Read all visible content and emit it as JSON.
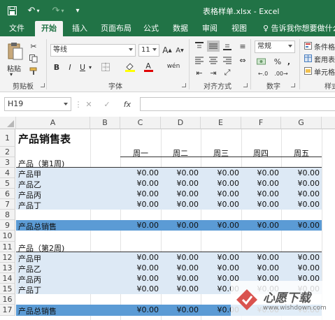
{
  "window": {
    "title": "表格样单.xlsx - Excel"
  },
  "tabs": [
    {
      "label": "文件"
    },
    {
      "label": "开始"
    },
    {
      "label": "插入"
    },
    {
      "label": "页面布局"
    },
    {
      "label": "公式"
    },
    {
      "label": "数据"
    },
    {
      "label": "审阅"
    },
    {
      "label": "视图"
    }
  ],
  "tell_me": "♀ 告诉我你想要做什么",
  "ribbon": {
    "clipboard": {
      "paste": "粘贴",
      "label": "剪贴板"
    },
    "font": {
      "name": "等线",
      "size": "11",
      "label": "字体",
      "bold": "B",
      "italic": "I",
      "underline": "U"
    },
    "alignment": {
      "label": "对齐方式"
    },
    "number": {
      "format": "常规",
      "label": "数字",
      "percent": "%",
      "comma": ","
    },
    "styles": {
      "conditional": "条件格",
      "table": "套用表",
      "cell": "单元格",
      "label": "样式"
    }
  },
  "formula_bar": {
    "name_box": "H19",
    "fx": "fx"
  },
  "grid": {
    "columns": [
      "A",
      "B",
      "C",
      "D",
      "E",
      "F",
      "G"
    ],
    "rows": [
      "1",
      "2",
      "3",
      "4",
      "5",
      "6",
      "7",
      "8",
      "9",
      "10",
      "11",
      "12",
      "13",
      "14",
      "15",
      "16",
      "17"
    ],
    "title": "产品销售表",
    "weekdays": [
      "周一",
      "周二",
      "周三",
      "周四",
      "周五"
    ],
    "section1": "产品（第1周)",
    "section2": "产品（第2周)",
    "products": [
      "产品甲",
      "产品乙",
      "产品丙",
      "产品丁"
    ],
    "total_label": "产品总销售",
    "value": "¥0.00"
  },
  "colors": {
    "excel_green": "#217346",
    "band_fill": "#dde9f5",
    "total_fill": "#5b9bd5"
  },
  "watermark": {
    "text": "心愿下载",
    "url": "www.wishdown.com"
  }
}
